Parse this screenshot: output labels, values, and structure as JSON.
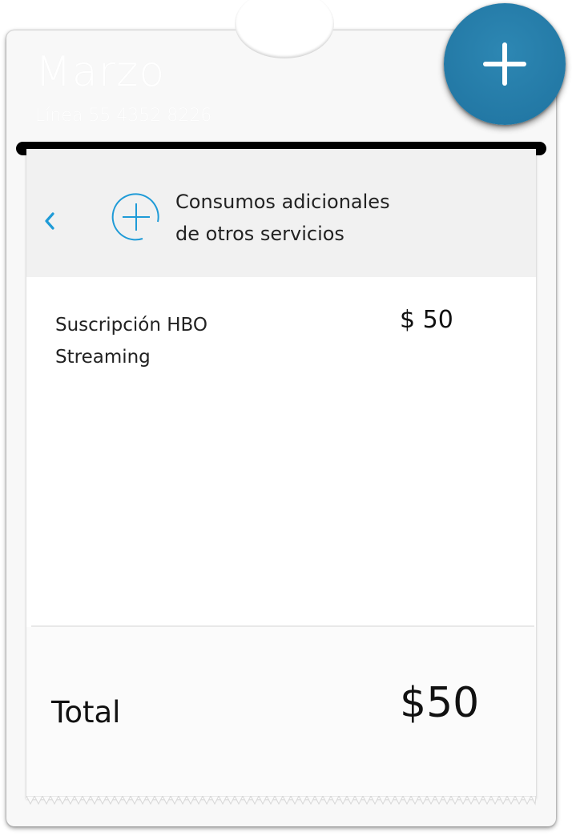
{
  "card": {
    "month": "Marzo",
    "line": "Línea 55 4352 8226"
  },
  "receipt": {
    "header_title_line1": "Consumos adicionales",
    "header_title_line2": "de otros servicios",
    "items": [
      {
        "name_line1": "Suscripción HBO",
        "name_line2": "Streaming",
        "price": "$ 50"
      }
    ],
    "total_label": "Total",
    "total_value": "$50"
  },
  "icons": {
    "back": "chevron-left-icon",
    "category": "plus-circle-icon",
    "fab": "plus-icon"
  },
  "colors": {
    "accent": "#1f9bd7",
    "fab": "#2379a6",
    "header_bg": "#f1f1f1"
  }
}
